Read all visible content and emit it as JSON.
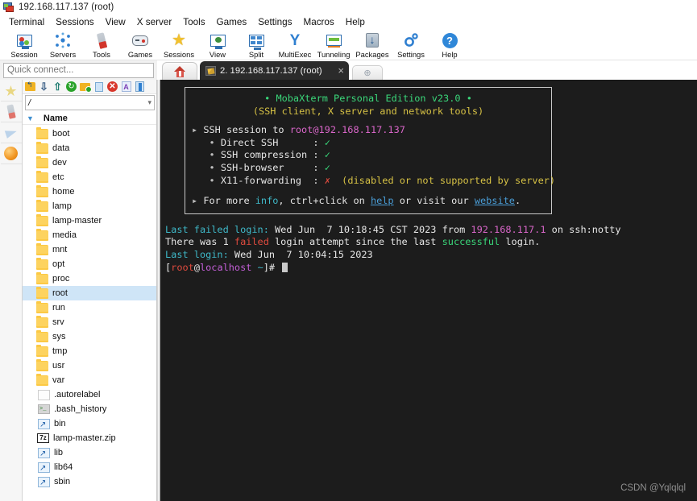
{
  "window": {
    "title": "192.168.117.137 (root)",
    "icon": "mobaxterm-icon"
  },
  "menubar": {
    "items": [
      {
        "label": "Terminal"
      },
      {
        "label": "Sessions"
      },
      {
        "label": "View"
      },
      {
        "label": "X server"
      },
      {
        "label": "Tools"
      },
      {
        "label": "Games"
      },
      {
        "label": "Settings"
      },
      {
        "label": "Macros"
      },
      {
        "label": "Help"
      }
    ]
  },
  "toolbar": {
    "buttons": [
      {
        "label": "Session",
        "icon": "session-monitor-icon"
      },
      {
        "label": "Servers",
        "icon": "servers-nodes-icon"
      },
      {
        "label": "Tools",
        "icon": "swiss-knife-icon"
      },
      {
        "label": "Games",
        "icon": "gamepad-icon"
      },
      {
        "label": "Sessions",
        "icon": "star-icon"
      },
      {
        "label": "View",
        "icon": "view-monitor-icon"
      },
      {
        "label": "Split",
        "icon": "split-grid-icon"
      },
      {
        "label": "MultiExec",
        "icon": "multiexec-y-icon"
      },
      {
        "label": "Tunneling",
        "icon": "tunneling-icon"
      },
      {
        "label": "Packages",
        "icon": "packages-download-icon"
      },
      {
        "label": "Settings",
        "icon": "gear-icon"
      },
      {
        "label": "Help",
        "icon": "help-question-icon"
      }
    ]
  },
  "quick_connect": {
    "placeholder": "Quick connect...",
    "value": ""
  },
  "tabs": {
    "home_tab_icon": "home-icon",
    "active": {
      "label": "2. 192.168.117.137 (root)",
      "icon": "terminal-tab-icon",
      "close_label": "×"
    },
    "new_tab_label": "⊕"
  },
  "left_rail": {
    "items": [
      {
        "name": "sessions-star",
        "icon": "star-icon"
      },
      {
        "name": "tools-knife",
        "icon": "swiss-knife-icon"
      },
      {
        "name": "macros-plane",
        "icon": "paper-plane-icon"
      },
      {
        "name": "globe",
        "icon": "globe-icon"
      }
    ]
  },
  "file_browser": {
    "toolbar_icons": [
      {
        "name": "parent-folder-icon"
      },
      {
        "name": "download-icon"
      },
      {
        "name": "upload-icon"
      },
      {
        "name": "refresh-icon"
      },
      {
        "name": "new-folder-icon"
      },
      {
        "name": "new-file-icon"
      },
      {
        "name": "delete-icon"
      },
      {
        "name": "font-icon"
      },
      {
        "name": "toggle-panel-icon"
      }
    ],
    "path": "/",
    "column_header": "Name",
    "sort_caret": "▼",
    "selected": "root",
    "items": [
      {
        "name": "boot",
        "type": "folder"
      },
      {
        "name": "data",
        "type": "folder"
      },
      {
        "name": "dev",
        "type": "folder"
      },
      {
        "name": "etc",
        "type": "folder"
      },
      {
        "name": "home",
        "type": "folder"
      },
      {
        "name": "lamp",
        "type": "folder"
      },
      {
        "name": "lamp-master",
        "type": "folder"
      },
      {
        "name": "media",
        "type": "folder"
      },
      {
        "name": "mnt",
        "type": "folder"
      },
      {
        "name": "opt",
        "type": "folder"
      },
      {
        "name": "proc",
        "type": "folder"
      },
      {
        "name": "root",
        "type": "folder"
      },
      {
        "name": "run",
        "type": "folder"
      },
      {
        "name": "srv",
        "type": "folder"
      },
      {
        "name": "sys",
        "type": "folder"
      },
      {
        "name": "tmp",
        "type": "folder"
      },
      {
        "name": "usr",
        "type": "folder"
      },
      {
        "name": "var",
        "type": "folder"
      },
      {
        "name": ".autorelabel",
        "type": "file"
      },
      {
        "name": ".bash_history",
        "type": "history"
      },
      {
        "name": "bin",
        "type": "link"
      },
      {
        "name": "lamp-master.zip",
        "type": "zip"
      },
      {
        "name": "lib",
        "type": "link"
      },
      {
        "name": "lib64",
        "type": "link"
      },
      {
        "name": "sbin",
        "type": "link"
      }
    ]
  },
  "terminal": {
    "banner": {
      "title_bullet_left": "• ",
      "title": "MobaXterm Personal Edition v23.0",
      "title_bullet_right": " •",
      "subtitle": "(SSH client, X server and network tools)",
      "session_arrow": "▸ ",
      "session_label": "SSH session to ",
      "session_target": "root@192.168.117.137",
      "features": [
        {
          "bullet": "• ",
          "label": "Direct SSH",
          "pad": "      : ",
          "mark": "✓",
          "ok": true,
          "note": ""
        },
        {
          "bullet": "• ",
          "label": "SSH compression",
          "pad": " : ",
          "mark": "✓",
          "ok": true,
          "note": ""
        },
        {
          "bullet": "• ",
          "label": "SSH-browser",
          "pad": "     : ",
          "mark": "✓",
          "ok": true,
          "note": ""
        },
        {
          "bullet": "• ",
          "label": "X11-forwarding",
          "pad": "  : ",
          "mark": "✗",
          "ok": false,
          "note": "disabled or not supported by server"
        }
      ],
      "footer_arrow": "▸ ",
      "footer_pre": "For more ",
      "footer_info": "info",
      "footer_mid": ", ctrl+click on ",
      "footer_help": "help",
      "footer_or": " or visit our ",
      "footer_site": "website",
      "footer_end": "."
    },
    "output": {
      "line1_a": "Last failed login:",
      "line1_b": " Wed Jun  7 10:18:45 CST 2023 from ",
      "line1_ip": "192.168.117.1",
      "line1_c": " on ssh:notty",
      "line2_a": "There was 1 ",
      "line2_failed": "failed",
      "line2_b": " login attempt since the last ",
      "line2_success": "successful",
      "line2_c": " login.",
      "line3_a": "Last login:",
      "line3_b": " Wed Jun  7 10:04:15 2023",
      "prompt_bracket_open": "[",
      "prompt_user": "root",
      "prompt_at": "@",
      "prompt_host": "localhost",
      "prompt_path": " ~",
      "prompt_bracket_close": "]# "
    },
    "watermark": "CSDN @Yqlqlql"
  },
  "colors": {
    "terminal_bg": "#1c1c1c",
    "accent_green": "#3ad77a",
    "accent_yellow": "#d7c245",
    "accent_pink": "#d966c9",
    "accent_cyan": "#3fb9c9",
    "accent_red": "#e04b3e",
    "selection_blue": "#cfe5f7"
  }
}
